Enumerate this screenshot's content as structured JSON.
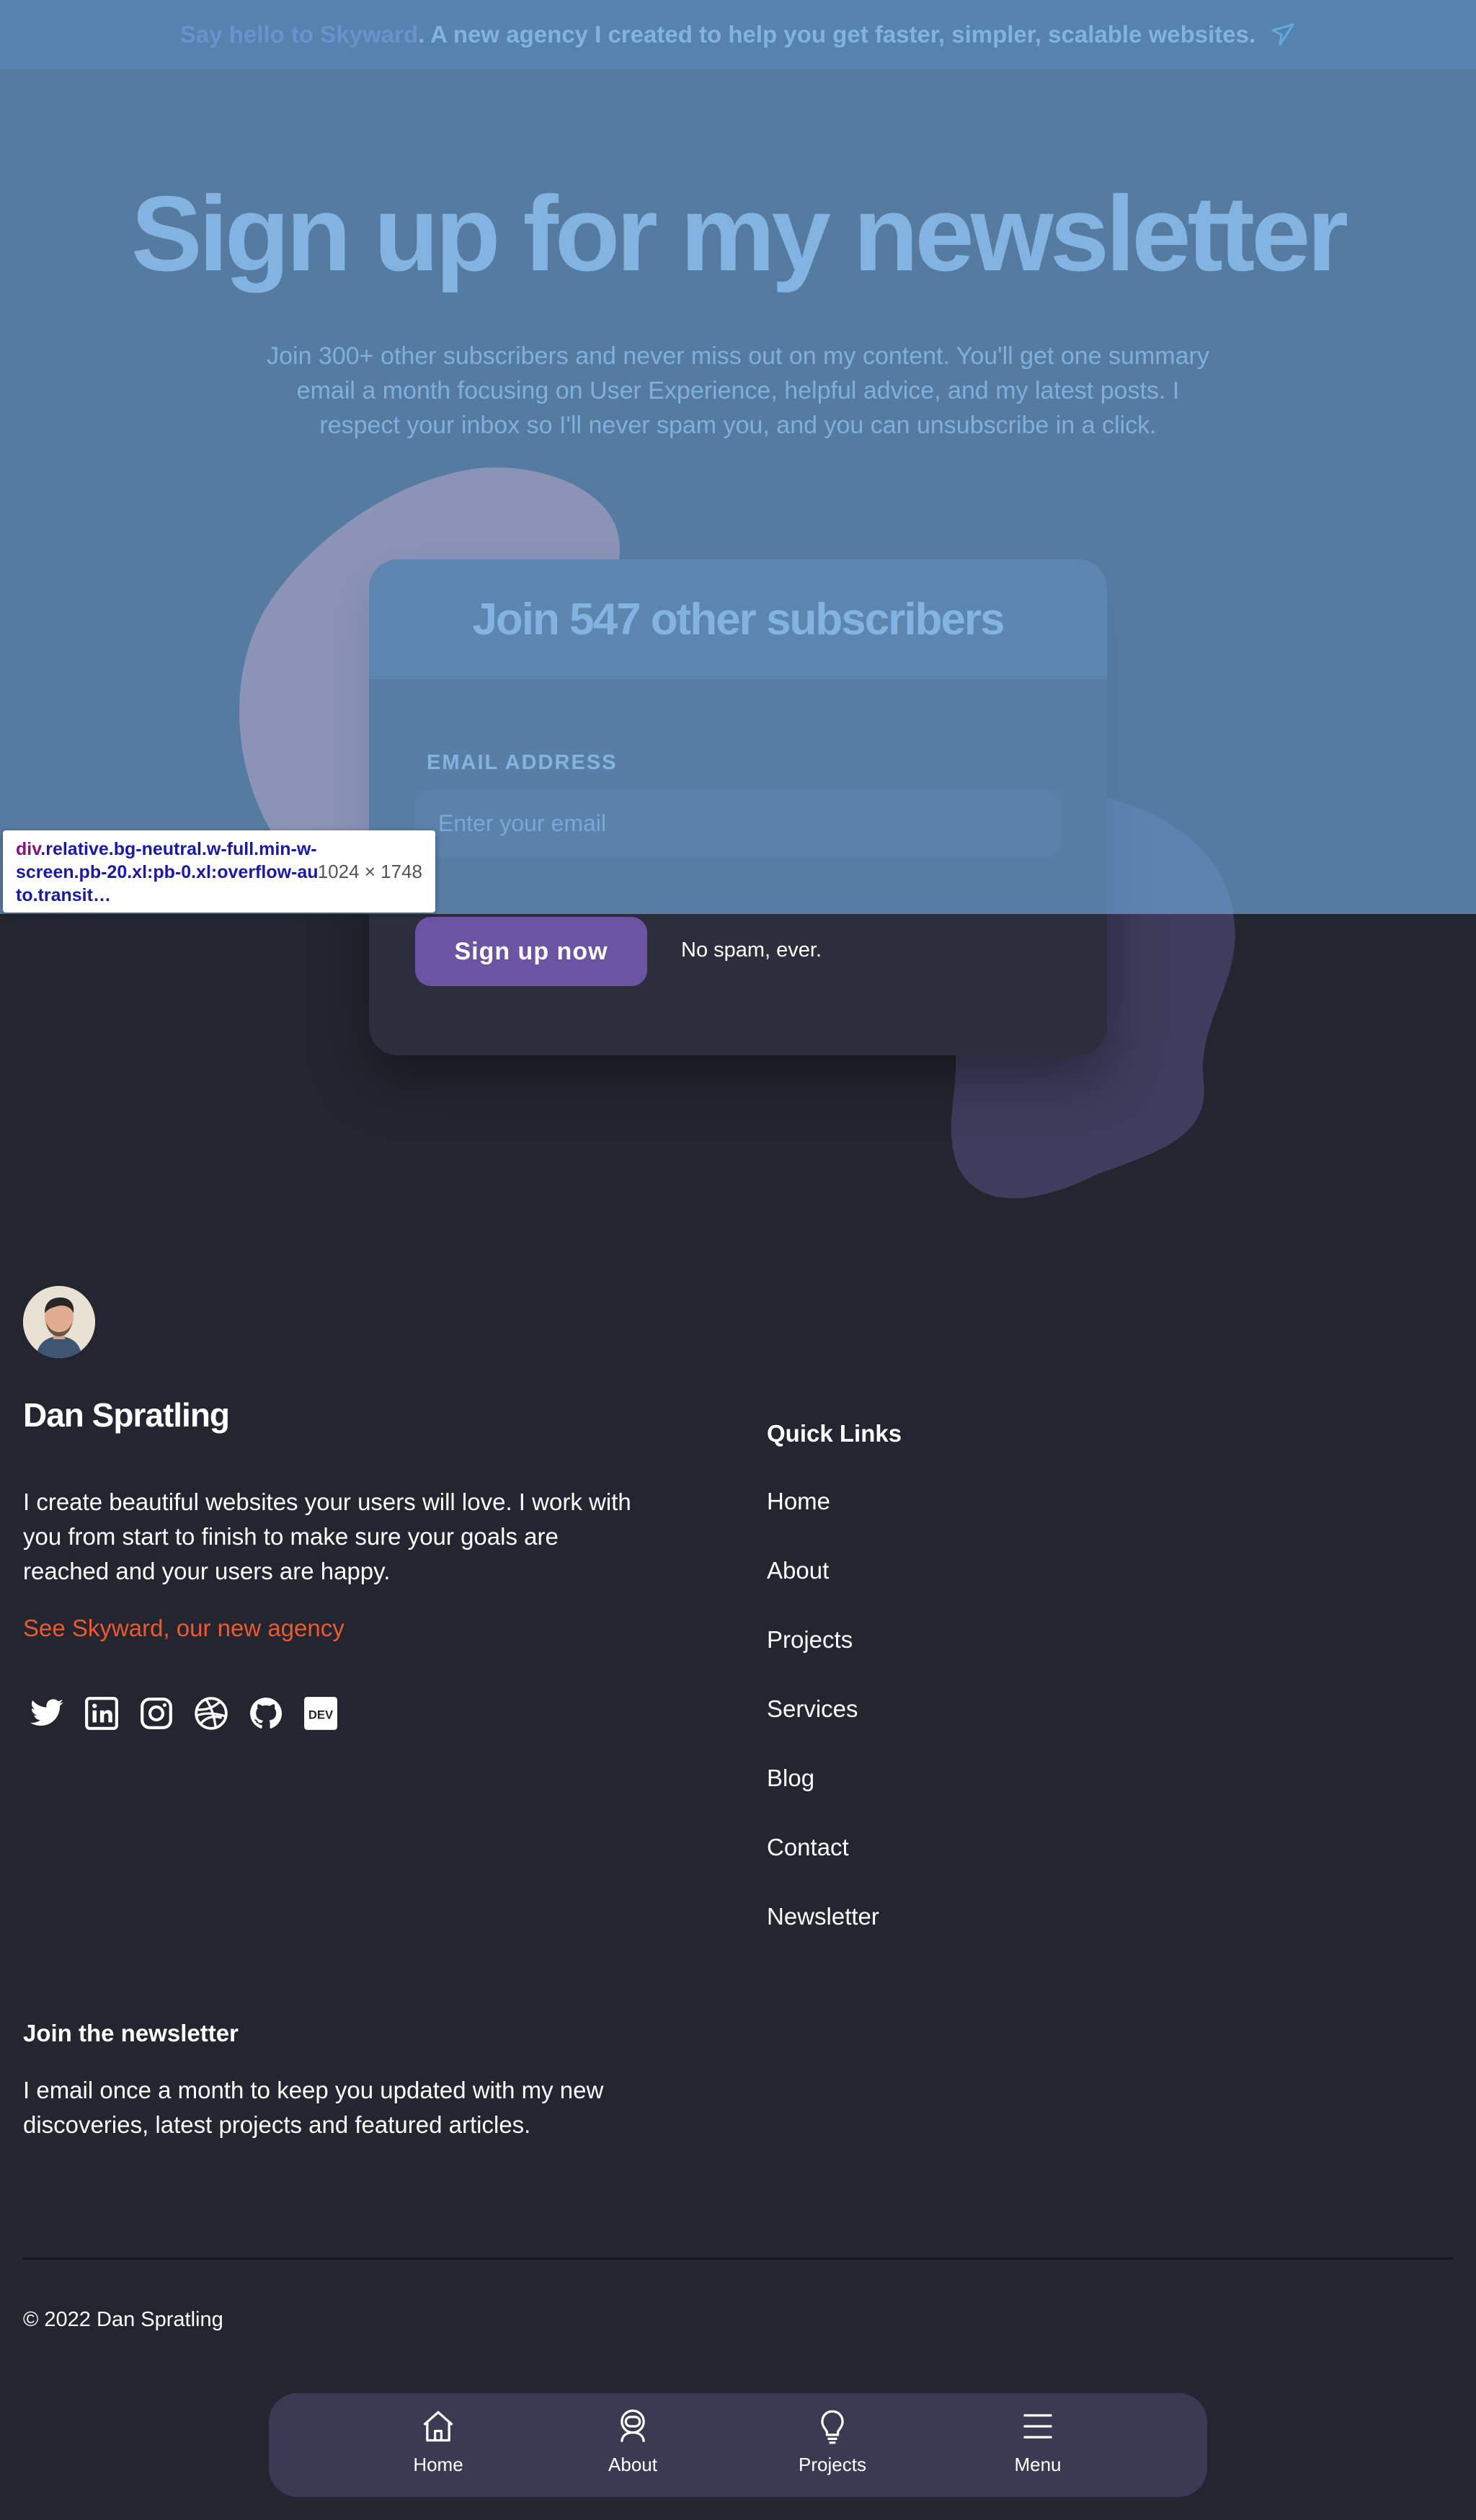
{
  "banner": {
    "brand_text": "Say hello to Skyward",
    "message": ". A new agency I created to help you get faster, simpler, scalable websites.",
    "icon": "send-arrow-icon"
  },
  "hero": {
    "title": "Sign up for my newsletter",
    "description": "Join 300+ other subscribers and never miss out on my content. You'll get one summary email a month focusing on User Experience, helpful advice, and my latest posts. I respect your inbox so I'll never spam you, and you can unsubscribe in a click."
  },
  "signup_card": {
    "title": "Join 547 other subscribers",
    "email_label": "EMAIL ADDRESS",
    "email_placeholder": "Enter your email",
    "email_value": "",
    "button_label": "Sign up now",
    "note": "No spam, ever."
  },
  "devtools_tooltip": {
    "tag": "div",
    "selector": ".relative.bg-neutral.w-full.min-w-screen.pb-20.xl:pb-0.xl:overflow-auto.transit…",
    "dimensions": "1024 × 1748"
  },
  "footer": {
    "author_name": "Dan Spratling",
    "bio": "I create beautiful websites your users will love. I work with you from start to finish to make sure your goals are reached and your users are happy.",
    "agency_link": "See Skyward, our new agency",
    "socials": [
      "twitter-icon",
      "linkedin-icon",
      "instagram-icon",
      "dribbble-icon",
      "github-icon",
      "dev-icon"
    ],
    "quick_links_title": "Quick Links",
    "quick_links": [
      "Home",
      "About",
      "Projects",
      "Services",
      "Blog",
      "Contact",
      "Newsletter"
    ],
    "newsletter_title": "Join the newsletter",
    "newsletter_desc": "I email once a month to keep you updated with my new discoveries, latest projects and featured articles.",
    "copyright": "© 2022 Dan Spratling"
  },
  "bottom_nav": {
    "items": [
      {
        "label": "Home",
        "icon": "home-icon"
      },
      {
        "label": "About",
        "icon": "astronaut-icon"
      },
      {
        "label": "Projects",
        "icon": "lightbulb-icon"
      },
      {
        "label": "Menu",
        "icon": "hamburger-menu-icon"
      }
    ]
  },
  "colors": {
    "background": "#232530",
    "card": "#2c2e3b",
    "button": "#6b54a3",
    "link_orange": "#ee5a2c",
    "overlay_blue": "#6fa8dc"
  }
}
